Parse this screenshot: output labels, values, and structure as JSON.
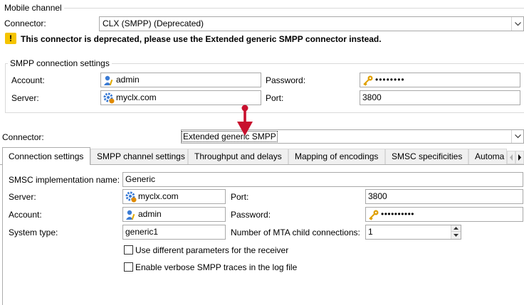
{
  "mobile": {
    "title": "Mobile channel",
    "connector_label": "Connector:",
    "connector_value": "CLX (SMPP) (Deprecated)",
    "warning_text": "This connector is deprecated, please use the Extended generic SMPP connector instead."
  },
  "smpp_group": {
    "title": "SMPP connection settings",
    "account_label": "Account:",
    "account_value": "admin",
    "password_label": "Password:",
    "password_value": "••••••••",
    "server_label": "Server:",
    "server_value": "myclx.com",
    "port_label": "Port:",
    "port_value": "3800"
  },
  "connector2": {
    "label": "Connector:",
    "value": "Extended generic SMPP"
  },
  "tabs": [
    {
      "label": "Connection settings"
    },
    {
      "label": "SMPP channel settings"
    },
    {
      "label": "Throughput and delays"
    },
    {
      "label": "Mapping of encodings"
    },
    {
      "label": "SMSC specificities"
    },
    {
      "label": "Automa"
    }
  ],
  "conn": {
    "smsc_label": "SMSC implementation name:",
    "smsc_value": "Generic",
    "server_label": "Server:",
    "server_value": "myclx.com",
    "port_label": "Port:",
    "port_value": "3800",
    "account_label": "Account:",
    "account_value": "admin",
    "password_label": "Password:",
    "password_value": "••••••••••",
    "systype_label": "System type:",
    "systype_value": "generic1",
    "mta_label": "Number of MTA child connections:",
    "mta_value": "1",
    "chk_receiver": "Use different parameters for the receiver",
    "chk_verbose": "Enable verbose SMPP traces in the log file"
  },
  "colors": {
    "warning": "#f5c400",
    "annotation_arrow": "#c8102e"
  }
}
